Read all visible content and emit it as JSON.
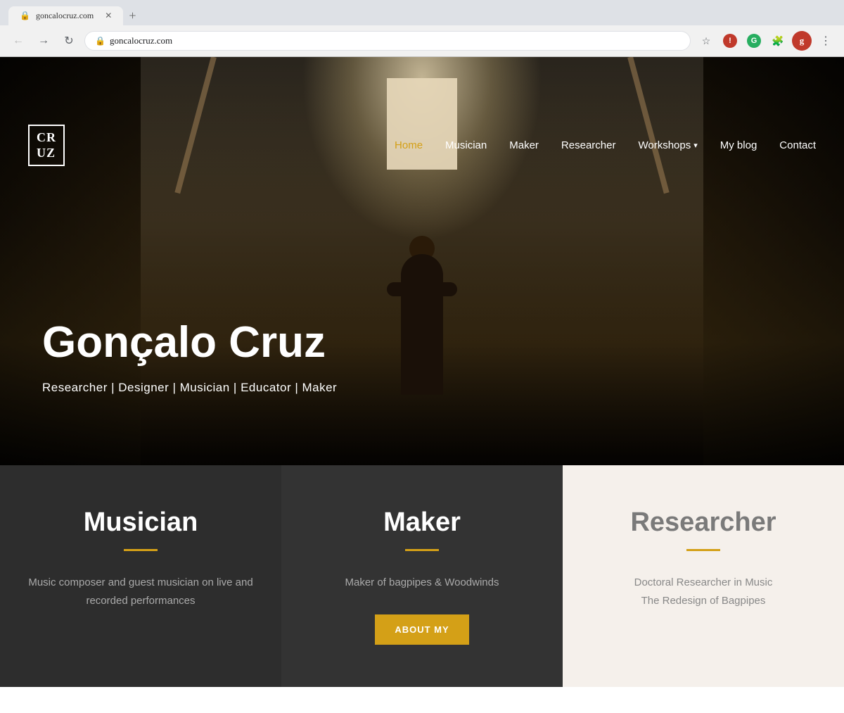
{
  "browser": {
    "url": "goncalocruz.com",
    "back_disabled": false,
    "forward_disabled": false,
    "tab_title": "goncalocruz.com"
  },
  "header": {
    "logo_line1": "CR",
    "logo_line2": "UZ",
    "nav": {
      "home": "Home",
      "musician": "Musician",
      "maker": "Maker",
      "researcher": "Researcher",
      "workshops": "Workshops",
      "workshops_chevron": "▾",
      "my_blog": "My blog",
      "contact": "Contact"
    }
  },
  "hero": {
    "title": "Gonçalo Cruz",
    "subtitle": "Researcher | Designer | Musician | Educator | Maker"
  },
  "cards": [
    {
      "id": "musician",
      "title": "Musician",
      "description": "Music composer and guest musician on live and recorded performances",
      "theme": "dark",
      "show_button": false
    },
    {
      "id": "maker",
      "title": "Maker",
      "description": "Maker of bagpipes & Woodwinds",
      "theme": "dark",
      "show_button": true,
      "button_label": "ABOUT MY"
    },
    {
      "id": "researcher",
      "title": "Researcher",
      "description": "Doctoral Researcher in Music\nThe Redesign of Bagpipes",
      "theme": "light",
      "show_button": false
    }
  ]
}
